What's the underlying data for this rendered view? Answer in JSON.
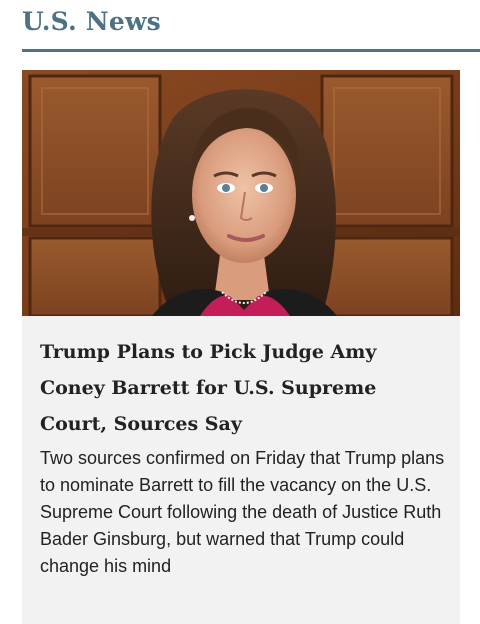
{
  "section": {
    "title": "U.S. News",
    "accent_color": "#4d7185"
  },
  "article": {
    "image_subject": "portrait-photo",
    "headline": "Trump Plans to Pick Judge Amy Coney Barrett for U.S. Supreme Court, Sources Say",
    "summary": "Two sources confirmed on Friday that Trump plans to nominate Barrett to fill the vacancy on the U.S. Supreme Court following the death of Justice Ruth Bader Ginsburg, but warned that Trump could change his mind"
  }
}
